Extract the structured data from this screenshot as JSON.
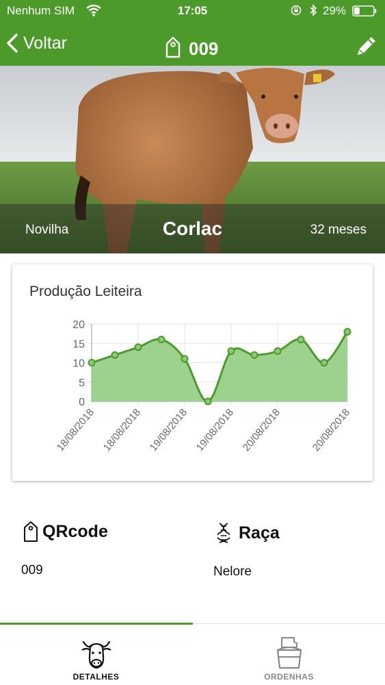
{
  "status_bar": {
    "carrier": "Nenhum SIM",
    "time": "17:05",
    "battery_percent": "29%",
    "battery_level": 0.29
  },
  "nav": {
    "back_label": "Voltar",
    "title": "009"
  },
  "hero": {
    "category": "Novilha",
    "name": "Corlac",
    "age": "32 meses"
  },
  "chart_card": {
    "title": "Produção Leiteira"
  },
  "chart_data": {
    "type": "area",
    "title": "Produção Leiteira",
    "x_tick_labels": [
      "18/08/2018",
      "18/08/2018",
      "19/08/2018",
      "19/08/2018",
      "20/08/2018",
      "20/08/2018"
    ],
    "values": [
      10,
      12,
      14,
      16,
      11,
      0,
      13,
      12,
      13,
      16,
      10,
      18
    ],
    "ylim": [
      0,
      20
    ],
    "y_ticks": [
      0,
      5,
      10,
      15,
      20
    ],
    "grid": true,
    "color": "#4c9a2a",
    "fill": "#8cc97a"
  },
  "info": {
    "qrcode_label": "QRcode",
    "qrcode_value": "009",
    "breed_label": "Raça",
    "breed_value": "Nelore"
  },
  "tabs": [
    {
      "label": "DETALHES",
      "icon": "cow-icon",
      "active": true
    },
    {
      "label": "ORDENHAS",
      "icon": "milk-bucket-icon",
      "active": false
    }
  ],
  "colors": {
    "primary": "#4c9a2a",
    "active_tab_text": "#111111",
    "inactive_tab_text": "#888888"
  }
}
